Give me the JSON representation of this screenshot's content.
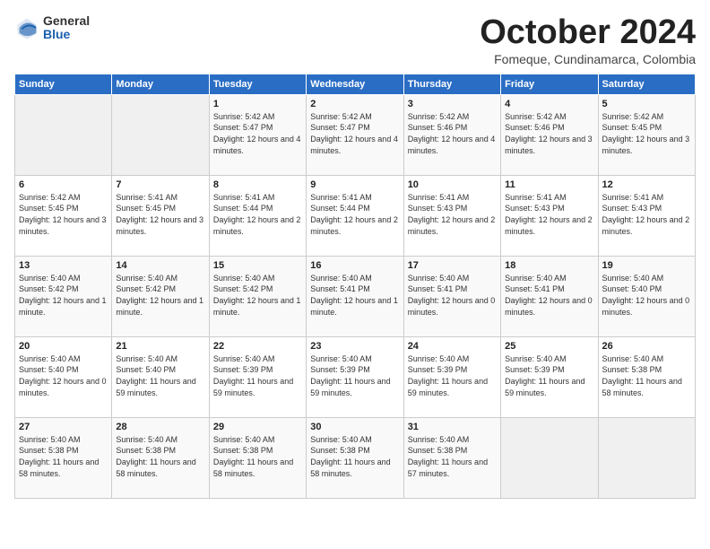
{
  "logo": {
    "general": "General",
    "blue": "Blue"
  },
  "header": {
    "month": "October 2024",
    "location": "Fomeque, Cundinamarca, Colombia"
  },
  "weekdays": [
    "Sunday",
    "Monday",
    "Tuesday",
    "Wednesday",
    "Thursday",
    "Friday",
    "Saturday"
  ],
  "weeks": [
    [
      {
        "day": "",
        "sunrise": "",
        "sunset": "",
        "daylight": ""
      },
      {
        "day": "",
        "sunrise": "",
        "sunset": "",
        "daylight": ""
      },
      {
        "day": "1",
        "sunrise": "Sunrise: 5:42 AM",
        "sunset": "Sunset: 5:47 PM",
        "daylight": "Daylight: 12 hours and 4 minutes."
      },
      {
        "day": "2",
        "sunrise": "Sunrise: 5:42 AM",
        "sunset": "Sunset: 5:47 PM",
        "daylight": "Daylight: 12 hours and 4 minutes."
      },
      {
        "day": "3",
        "sunrise": "Sunrise: 5:42 AM",
        "sunset": "Sunset: 5:46 PM",
        "daylight": "Daylight: 12 hours and 4 minutes."
      },
      {
        "day": "4",
        "sunrise": "Sunrise: 5:42 AM",
        "sunset": "Sunset: 5:46 PM",
        "daylight": "Daylight: 12 hours and 3 minutes."
      },
      {
        "day": "5",
        "sunrise": "Sunrise: 5:42 AM",
        "sunset": "Sunset: 5:45 PM",
        "daylight": "Daylight: 12 hours and 3 minutes."
      }
    ],
    [
      {
        "day": "6",
        "sunrise": "Sunrise: 5:42 AM",
        "sunset": "Sunset: 5:45 PM",
        "daylight": "Daylight: 12 hours and 3 minutes."
      },
      {
        "day": "7",
        "sunrise": "Sunrise: 5:41 AM",
        "sunset": "Sunset: 5:45 PM",
        "daylight": "Daylight: 12 hours and 3 minutes."
      },
      {
        "day": "8",
        "sunrise": "Sunrise: 5:41 AM",
        "sunset": "Sunset: 5:44 PM",
        "daylight": "Daylight: 12 hours and 2 minutes."
      },
      {
        "day": "9",
        "sunrise": "Sunrise: 5:41 AM",
        "sunset": "Sunset: 5:44 PM",
        "daylight": "Daylight: 12 hours and 2 minutes."
      },
      {
        "day": "10",
        "sunrise": "Sunrise: 5:41 AM",
        "sunset": "Sunset: 5:43 PM",
        "daylight": "Daylight: 12 hours and 2 minutes."
      },
      {
        "day": "11",
        "sunrise": "Sunrise: 5:41 AM",
        "sunset": "Sunset: 5:43 PM",
        "daylight": "Daylight: 12 hours and 2 minutes."
      },
      {
        "day": "12",
        "sunrise": "Sunrise: 5:41 AM",
        "sunset": "Sunset: 5:43 PM",
        "daylight": "Daylight: 12 hours and 2 minutes."
      }
    ],
    [
      {
        "day": "13",
        "sunrise": "Sunrise: 5:40 AM",
        "sunset": "Sunset: 5:42 PM",
        "daylight": "Daylight: 12 hours and 1 minute."
      },
      {
        "day": "14",
        "sunrise": "Sunrise: 5:40 AM",
        "sunset": "Sunset: 5:42 PM",
        "daylight": "Daylight: 12 hours and 1 minute."
      },
      {
        "day": "15",
        "sunrise": "Sunrise: 5:40 AM",
        "sunset": "Sunset: 5:42 PM",
        "daylight": "Daylight: 12 hours and 1 minute."
      },
      {
        "day": "16",
        "sunrise": "Sunrise: 5:40 AM",
        "sunset": "Sunset: 5:41 PM",
        "daylight": "Daylight: 12 hours and 1 minute."
      },
      {
        "day": "17",
        "sunrise": "Sunrise: 5:40 AM",
        "sunset": "Sunset: 5:41 PM",
        "daylight": "Daylight: 12 hours and 0 minutes."
      },
      {
        "day": "18",
        "sunrise": "Sunrise: 5:40 AM",
        "sunset": "Sunset: 5:41 PM",
        "daylight": "Daylight: 12 hours and 0 minutes."
      },
      {
        "day": "19",
        "sunrise": "Sunrise: 5:40 AM",
        "sunset": "Sunset: 5:40 PM",
        "daylight": "Daylight: 12 hours and 0 minutes."
      }
    ],
    [
      {
        "day": "20",
        "sunrise": "Sunrise: 5:40 AM",
        "sunset": "Sunset: 5:40 PM",
        "daylight": "Daylight: 12 hours and 0 minutes."
      },
      {
        "day": "21",
        "sunrise": "Sunrise: 5:40 AM",
        "sunset": "Sunset: 5:40 PM",
        "daylight": "Daylight: 11 hours and 59 minutes."
      },
      {
        "day": "22",
        "sunrise": "Sunrise: 5:40 AM",
        "sunset": "Sunset: 5:39 PM",
        "daylight": "Daylight: 11 hours and 59 minutes."
      },
      {
        "day": "23",
        "sunrise": "Sunrise: 5:40 AM",
        "sunset": "Sunset: 5:39 PM",
        "daylight": "Daylight: 11 hours and 59 minutes."
      },
      {
        "day": "24",
        "sunrise": "Sunrise: 5:40 AM",
        "sunset": "Sunset: 5:39 PM",
        "daylight": "Daylight: 11 hours and 59 minutes."
      },
      {
        "day": "25",
        "sunrise": "Sunrise: 5:40 AM",
        "sunset": "Sunset: 5:39 PM",
        "daylight": "Daylight: 11 hours and 59 minutes."
      },
      {
        "day": "26",
        "sunrise": "Sunrise: 5:40 AM",
        "sunset": "Sunset: 5:38 PM",
        "daylight": "Daylight: 11 hours and 58 minutes."
      }
    ],
    [
      {
        "day": "27",
        "sunrise": "Sunrise: 5:40 AM",
        "sunset": "Sunset: 5:38 PM",
        "daylight": "Daylight: 11 hours and 58 minutes."
      },
      {
        "day": "28",
        "sunrise": "Sunrise: 5:40 AM",
        "sunset": "Sunset: 5:38 PM",
        "daylight": "Daylight: 11 hours and 58 minutes."
      },
      {
        "day": "29",
        "sunrise": "Sunrise: 5:40 AM",
        "sunset": "Sunset: 5:38 PM",
        "daylight": "Daylight: 11 hours and 58 minutes."
      },
      {
        "day": "30",
        "sunrise": "Sunrise: 5:40 AM",
        "sunset": "Sunset: 5:38 PM",
        "daylight": "Daylight: 11 hours and 58 minutes."
      },
      {
        "day": "31",
        "sunrise": "Sunrise: 5:40 AM",
        "sunset": "Sunset: 5:38 PM",
        "daylight": "Daylight: 11 hours and 57 minutes."
      },
      {
        "day": "",
        "sunrise": "",
        "sunset": "",
        "daylight": ""
      },
      {
        "day": "",
        "sunrise": "",
        "sunset": "",
        "daylight": ""
      }
    ]
  ]
}
